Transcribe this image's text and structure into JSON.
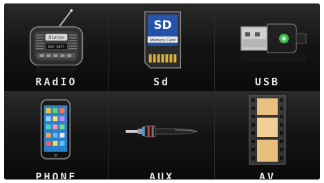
{
  "menu": {
    "items": [
      {
        "label": "RAdIO",
        "icon": "radio-icon"
      },
      {
        "label": "Sd",
        "icon": "sd-card-icon"
      },
      {
        "label": "USB",
        "icon": "usb-icon"
      },
      {
        "label": "PHONE",
        "icon": "phone-icon"
      },
      {
        "label": "AUX",
        "icon": "aux-cable-icon"
      },
      {
        "label": "AV",
        "icon": "film-icon"
      }
    ]
  },
  "radio": {
    "badge": "Stereo",
    "sub": "DSP-3077"
  },
  "sd": {
    "title": "SD",
    "caption": "Memory Card"
  },
  "colors": {
    "background": "#0c0c0c",
    "label": "#e6e6e6",
    "sd_blue": "#1f4fa8",
    "usb_green": "#3fb84a",
    "film_tan": "#e8bf7e"
  }
}
